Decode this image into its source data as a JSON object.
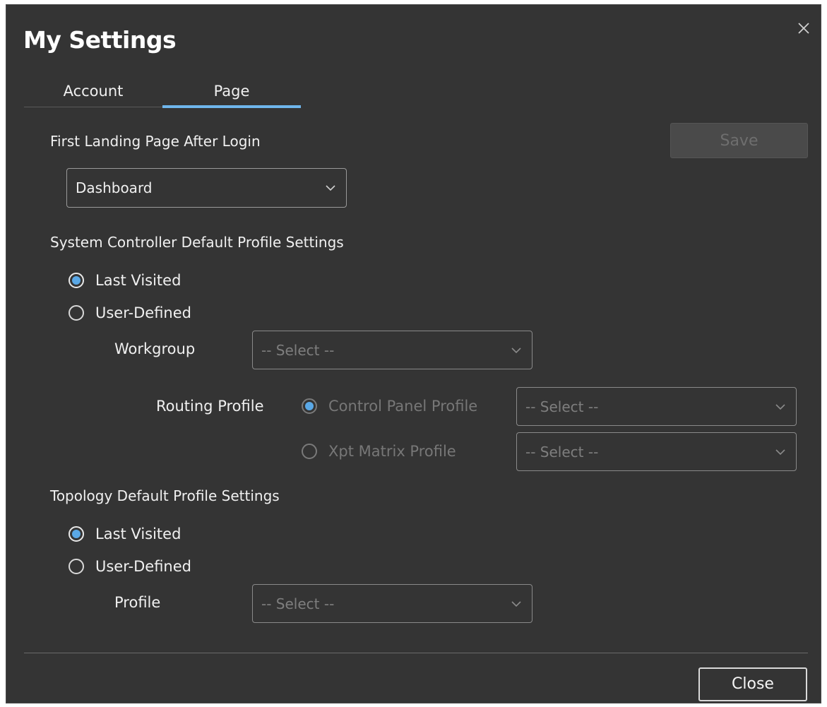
{
  "dialog": {
    "title": "My Settings",
    "close_icon": "close-icon"
  },
  "tabs": [
    {
      "label": "Account",
      "active": false
    },
    {
      "label": "Page",
      "active": true
    }
  ],
  "landing": {
    "label": "First Landing Page After Login",
    "select_value": "Dashboard"
  },
  "save_label": "Save",
  "system_controller": {
    "label": "System Controller Default Profile Settings",
    "options": [
      {
        "label": "Last Visited",
        "checked": true
      },
      {
        "label": "User-Defined",
        "checked": false
      }
    ],
    "workgroup_label": "Workgroup",
    "workgroup_select": "-- Select --",
    "routing_label": "Routing Profile",
    "routing_options": [
      {
        "label": "Control Panel Profile",
        "checked": true,
        "select": "-- Select --"
      },
      {
        "label": "Xpt Matrix Profile",
        "checked": false,
        "select": "-- Select --"
      }
    ]
  },
  "topology": {
    "label": "Topology Default Profile Settings",
    "options": [
      {
        "label": "Last Visited",
        "checked": true
      },
      {
        "label": "User-Defined",
        "checked": false
      }
    ],
    "profile_label": "Profile",
    "profile_select": "-- Select --"
  },
  "close_label": "Close",
  "colors": {
    "background": "#343434",
    "accent": "#5aa8e6",
    "tab_underline": "#6fb6ec"
  }
}
